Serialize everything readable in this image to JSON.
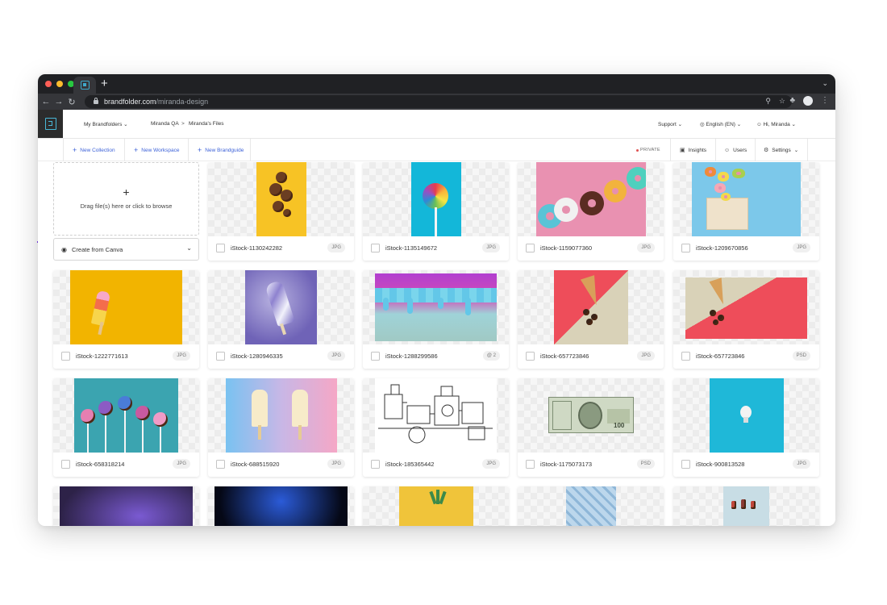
{
  "browser": {
    "url_host": "brandfolder.com",
    "url_path": "/miranda-design",
    "traffic_colors": [
      "#ff5f57",
      "#febc2e",
      "#28c840"
    ]
  },
  "header": {
    "my_brandfolders": "My Brandfolders",
    "crumb_org": "Miranda QA",
    "crumb_sep": ">",
    "crumb_current": "Miranda's Files",
    "support": "Support",
    "language": "English (EN)",
    "greeting": "Hi, Miranda"
  },
  "toolbar": {
    "new_collection": "New Collection",
    "new_workspace": "New Workspace",
    "new_brandguide": "New Brandguide",
    "private": "PRIVATE",
    "insights": "Insights",
    "users": "Users",
    "settings": "Settings"
  },
  "upload": {
    "hint": "Drag file(s) here or click to browse",
    "canva_label": "Create from Canva"
  },
  "assets": [
    {
      "name": "iStock-1130242282",
      "badge": "JPG"
    },
    {
      "name": "iStock-1135149672",
      "badge": "JPG"
    },
    {
      "name": "iStock-1159077360",
      "badge": "JPG"
    },
    {
      "name": "iStock-1209670856",
      "badge": "JPG"
    },
    {
      "name": "iStock-1222771613",
      "badge": "JPG"
    },
    {
      "name": "iStock-1280946335",
      "badge": "JPG"
    },
    {
      "name": "iStock-1288299586",
      "badge": "@ 2"
    },
    {
      "name": "iStock-657723846",
      "badge": "JPG"
    },
    {
      "name": "iStock-657723846",
      "badge": "PSD"
    },
    {
      "name": "iStock-658318214",
      "badge": "JPG"
    },
    {
      "name": "iStock-688515920",
      "badge": "JPG"
    },
    {
      "name": "iStock-185365442",
      "badge": "JPG"
    },
    {
      "name": "iStock-1175073173",
      "badge": "PSD"
    },
    {
      "name": "iStock-900813528",
      "badge": "JPG"
    }
  ],
  "money_label": "100",
  "colors": {
    "accent": "#3d62d8",
    "brand": "#49b8d7",
    "private_dot": "#e05252"
  }
}
